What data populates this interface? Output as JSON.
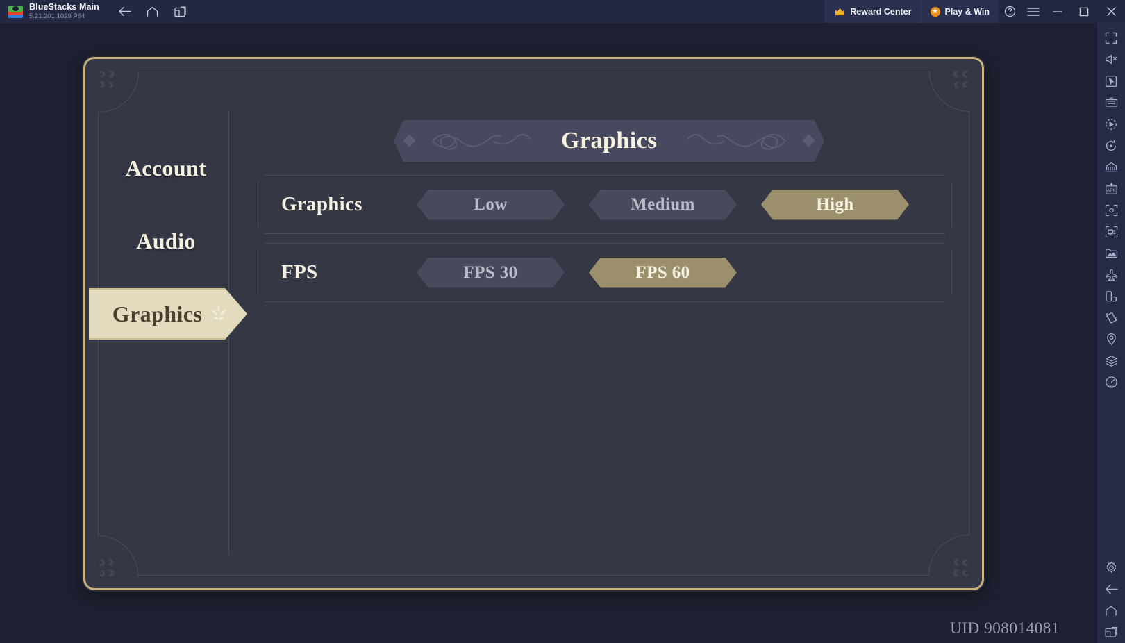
{
  "titlebar": {
    "app_name": "BlueStacks Main",
    "version": "5.21.201.1029  P64",
    "nav": [
      {
        "name": "back-icon",
        "label": "Back"
      },
      {
        "name": "home-icon",
        "label": "Home"
      },
      {
        "name": "multi-instance-icon",
        "label": "Instance Manager"
      }
    ],
    "reward_center": "Reward Center",
    "play_and_win": "Play & Win",
    "help_label": "Help",
    "menu_label": "Menu",
    "minimize_label": "Minimize",
    "maximize_label": "Maximize",
    "close_label": "Close"
  },
  "rail": {
    "items": [
      {
        "name": "fullscreen-icon",
        "label": "Full screen"
      },
      {
        "name": "mute-icon",
        "label": "Mute"
      },
      {
        "name": "cursor-icon",
        "label": "Cursor control"
      },
      {
        "name": "keyboard-icon",
        "label": "Game controls"
      },
      {
        "name": "macro-icon",
        "label": "Macro recorder"
      },
      {
        "name": "rotate-icon",
        "label": "Rotate"
      },
      {
        "name": "multi-instance-sync-icon",
        "label": "Multi-instance sync"
      },
      {
        "name": "install-apk-icon",
        "label": "Install APK"
      },
      {
        "name": "screenshot-icon",
        "label": "Screenshot"
      },
      {
        "name": "record-video-icon",
        "label": "Record screen"
      },
      {
        "name": "media-manager-icon",
        "label": "Media manager"
      },
      {
        "name": "airplane-icon",
        "label": "Airplane mode"
      },
      {
        "name": "device-resize-icon",
        "label": "Resize display"
      },
      {
        "name": "shake-icon",
        "label": "Shake"
      },
      {
        "name": "location-icon",
        "label": "Location"
      },
      {
        "name": "eco-mode-icon",
        "label": "Eco mode"
      },
      {
        "name": "performance-icon",
        "label": "Performance"
      }
    ],
    "bottom_items": [
      {
        "name": "settings-gear-icon",
        "label": "Settings"
      },
      {
        "name": "android-back-icon",
        "label": "Back"
      },
      {
        "name": "android-home-icon",
        "label": "Home"
      },
      {
        "name": "android-recents-icon",
        "label": "Recent apps"
      }
    ]
  },
  "game": {
    "header_title": "Graphics",
    "sidebar_tabs": [
      {
        "label": "Account",
        "active": false
      },
      {
        "label": "Audio",
        "active": false
      },
      {
        "label": "Graphics",
        "active": true
      }
    ],
    "settings": [
      {
        "label": "Graphics",
        "options": [
          {
            "label": "Low",
            "selected": false
          },
          {
            "label": "Medium",
            "selected": false
          },
          {
            "label": "High",
            "selected": true
          }
        ]
      },
      {
        "label": "FPS",
        "options": [
          {
            "label": "FPS 30",
            "selected": false
          },
          {
            "label": "FPS 60",
            "selected": true
          }
        ]
      }
    ],
    "uid": "UID 908014081"
  },
  "colors": {
    "panel_bg": "#343744",
    "frame_gold": "#c8b27e",
    "selected_gold": "#9c8f6c",
    "option_bg": "#474a5c",
    "active_tab_bg": "#e3dbbe",
    "titlebar_bg": "#242741",
    "rail_bg": "#272b48"
  }
}
